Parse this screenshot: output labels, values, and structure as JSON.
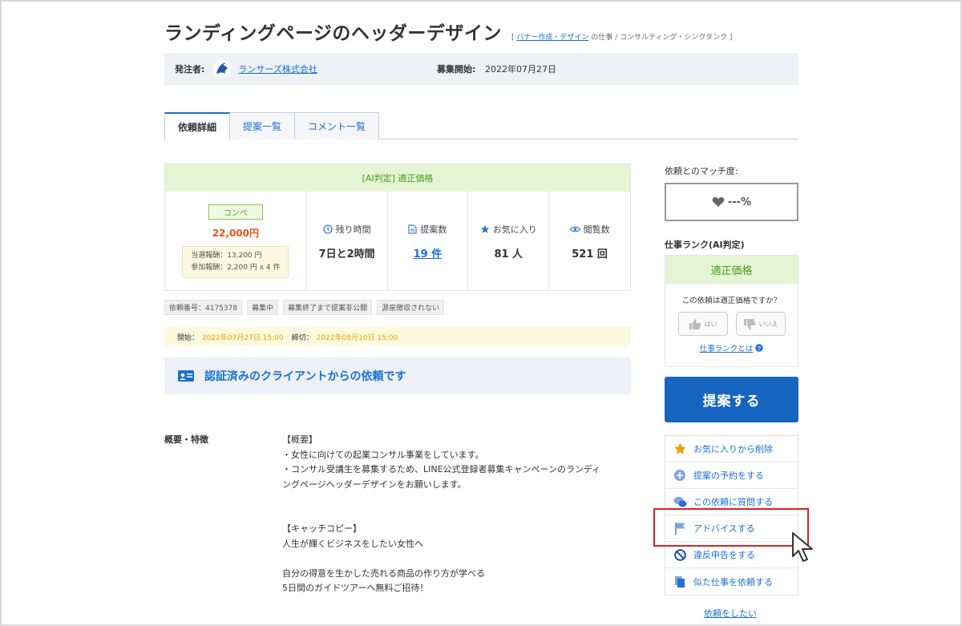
{
  "header": {
    "title": "ランディングページのヘッダーデザイン",
    "category_open": "[",
    "category_link": "バナー作成・デザイン",
    "category_rest": "の仕事 / コンサルティング・シンクタンク ]"
  },
  "client": {
    "label": "発注者:",
    "name": "ランサーズ株式会社",
    "start_label": "募集開始:",
    "start_date": "2022年07月27日"
  },
  "tabs": [
    {
      "label": "依頼詳細"
    },
    {
      "label": "提案一覧"
    },
    {
      "label": "コメント一覧"
    }
  ],
  "ai_judge": {
    "header": "[AI判定] 適正価格",
    "type_badge": "コンペ",
    "price": "22,000円",
    "reward_winner": "当選報酬：13,200 円",
    "reward_participate": "参加報酬：2,200 円 x 4 件",
    "remaining_label": "残り時間",
    "remaining_value": "7日と2時間",
    "proposals_label": "提案数",
    "proposals_value": "19 件",
    "favorites_label": "お気に入り",
    "favorites_value": "81 人",
    "views_label": "閲覧数",
    "views_value": "521 回"
  },
  "tags": [
    {
      "label": "依頼番号：4175378"
    },
    {
      "label": "募集中"
    },
    {
      "label": "募集終了まで提案非公開"
    },
    {
      "label": "源泉徴収されない"
    }
  ],
  "dates": {
    "start_label": "開始：",
    "start_value": "2022年07月27日 15:00",
    "end_label": "締切：",
    "end_value": "2022年08月10日 15:00"
  },
  "verified": {
    "text": "認証済みのクライアントからの依頼です"
  },
  "description": {
    "label": "概要・特徴",
    "lines": [
      "【概要】",
      "・女性に向けての起業コンサル事業をしています。",
      "・コンサル受講生を募集するため、LINE公式登録者募集キャンペーンのランディ",
      "ングページヘッダーデザインをお願いします。",
      "",
      "",
      "【キャッチコピー】",
      "人生が輝くビジネスをしたい女性へ",
      "",
      "自分の得意を生かした売れる商品の作り方が学べる",
      "5日間のガイドツアーへ無料ご招待！"
    ]
  },
  "sidebar": {
    "match_label": "依頼とのマッチ度:",
    "match_value": "---%",
    "rank_label": "仕事ランク(AI判定)",
    "rank_value": "適正価格",
    "rank_question": "この依頼は適正価格ですか？",
    "vote_yes": "はい",
    "vote_no": "いいえ",
    "rank_link": "仕事ランクとは",
    "propose_button": "提案する",
    "actions": [
      {
        "label": "お気に入りから削除",
        "icon": "star-icon"
      },
      {
        "label": "提案の予約をする",
        "icon": "calendar-plus-icon"
      },
      {
        "label": "この依頼に質問する",
        "icon": "chat-bubbles-icon"
      },
      {
        "label": "アドバイスする",
        "icon": "flag-icon"
      },
      {
        "label": "違反申告をする",
        "icon": "prohibit-icon"
      },
      {
        "label": "似た仕事を依頼する",
        "icon": "copy-icon"
      }
    ],
    "want_link": "依頼をしたい"
  },
  "colors": {
    "accent_blue": "#1565c0",
    "link_blue": "#1a6fd6",
    "price_orange": "#e6541a",
    "ai_green": "#4a9a18",
    "highlight_red": "#e02020"
  }
}
